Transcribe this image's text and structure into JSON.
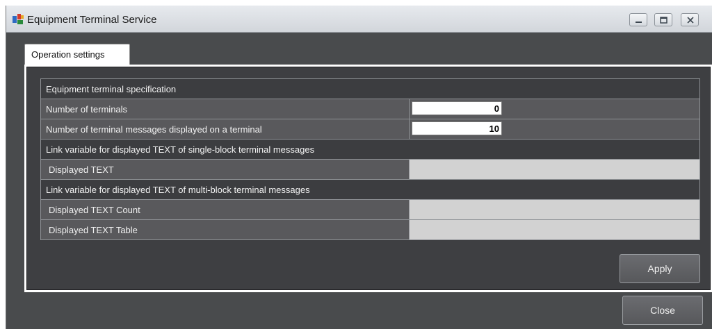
{
  "window": {
    "title": "Equipment Terminal Service",
    "controls": [
      "minimize-icon",
      "maximize-icon",
      "close-icon"
    ]
  },
  "tabs": [
    {
      "label": "Operation settings",
      "active": true
    }
  ],
  "settings": {
    "spec_header": "Equipment terminal specification",
    "num_terminals_label": "Number of terminals",
    "num_terminals_value": "0",
    "num_messages_label": "Number of terminal messages displayed on a terminal",
    "num_messages_value": "10",
    "single_block_header": "Link variable for displayed TEXT of single-block terminal messages",
    "displayed_text_label": "Displayed TEXT",
    "multi_block_header": "Link variable for displayed TEXT of multi-block terminal messages",
    "displayed_text_count_label": "Displayed TEXT Count",
    "displayed_text_table_label": "Displayed TEXT Table"
  },
  "buttons": {
    "apply": "Apply",
    "close": "Close"
  },
  "colors": {
    "window_bg": "#494b4d",
    "header_row": "#3c3d40",
    "label_cell": "#59595c",
    "disabled_value": "#d2d2d2"
  }
}
